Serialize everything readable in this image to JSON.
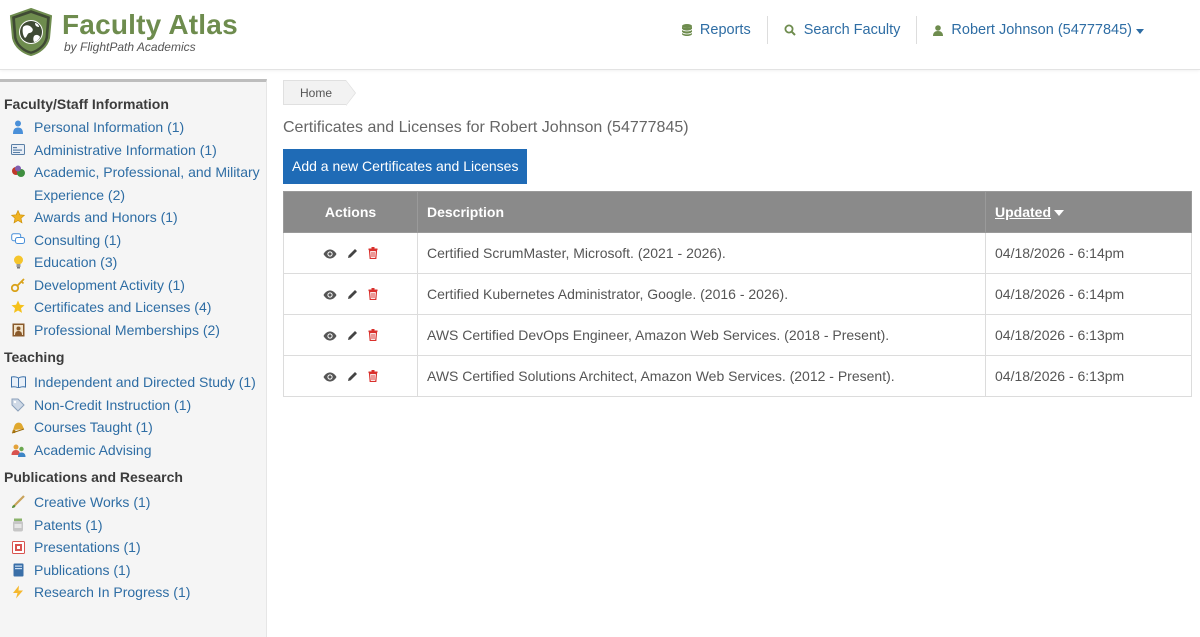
{
  "app": {
    "title": "Faculty Atlas",
    "subtitle": "by FlightPath Academics"
  },
  "topnav": {
    "reports_label": "Reports",
    "search_label": "Search Faculty",
    "user_label": "Robert Johnson (54777845)"
  },
  "sidebar": {
    "sections": [
      {
        "title": "Faculty/Staff Information",
        "items": [
          {
            "label": "Personal Information (1)",
            "icon": "person-icon"
          },
          {
            "label": "Administrative Information (1)",
            "icon": "id-card-icon"
          },
          {
            "label": "Academic, Professional, and Military Experience (2)",
            "icon": "medals-icon"
          },
          {
            "label": "Awards and Honors (1)",
            "icon": "award-star-icon"
          },
          {
            "label": "Consulting (1)",
            "icon": "chat-bubble-icon"
          },
          {
            "label": "Education (3)",
            "icon": "lightbulb-icon"
          },
          {
            "label": "Development Activity (1)",
            "icon": "key-icon"
          },
          {
            "label": "Certificates and Licenses (4)",
            "icon": "star-icon"
          },
          {
            "label": "Professional Memberships (2)",
            "icon": "portrait-icon"
          }
        ]
      },
      {
        "title": "Teaching",
        "items": [
          {
            "label": "Independent and Directed Study (1)",
            "icon": "open-book-icon"
          },
          {
            "label": "Non-Credit Instruction (1)",
            "icon": "tag-icon"
          },
          {
            "label": "Courses Taught (1)",
            "icon": "bell-icon"
          },
          {
            "label": "Academic Advising",
            "icon": "people-icon"
          }
        ]
      },
      {
        "title": "Publications and Research",
        "items": [
          {
            "label": "Creative Works (1)",
            "icon": "brush-icon"
          },
          {
            "label": "Patents (1)",
            "icon": "jar-icon"
          },
          {
            "label": "Presentations (1)",
            "icon": "presentation-icon"
          },
          {
            "label": "Publications (1)",
            "icon": "book-icon"
          },
          {
            "label": "Research In Progress (1)",
            "icon": "lightning-icon"
          }
        ]
      }
    ]
  },
  "main": {
    "breadcrumb": "Home",
    "page_title": "Certificates and Licenses for Robert Johnson (54777845)",
    "add_button": "Add a new Certificates and Licenses",
    "table": {
      "headers": {
        "actions": "Actions",
        "description": "Description",
        "updated": "Updated"
      },
      "rows": [
        {
          "description": "Certified ScrumMaster, Microsoft. (2021 - 2026).",
          "updated": "04/18/2026 - 6:14pm"
        },
        {
          "description": "Certified Kubernetes Administrator, Google. (2016 - 2026).",
          "updated": "04/18/2026 - 6:14pm"
        },
        {
          "description": "AWS Certified DevOps Engineer, Amazon Web Services. (2018 - Present).",
          "updated": "04/18/2026 - 6:13pm"
        },
        {
          "description": "AWS Certified Solutions Architect, Amazon Web Services. (2012 - Present).",
          "updated": "04/18/2026 - 6:13pm"
        }
      ]
    }
  },
  "colors": {
    "brand_green": "#6e8c4e",
    "link_blue": "#2e6da4",
    "button_blue": "#1f6bb6",
    "table_header": "#8a8a8a",
    "delete_red": "#d9302c"
  }
}
